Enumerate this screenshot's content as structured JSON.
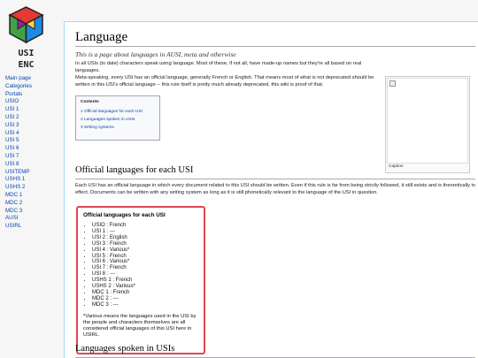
{
  "logo": {
    "line1": "USI",
    "line2": "ENC"
  },
  "sidebar": {
    "items": [
      "Main page",
      "Categories",
      "Portals",
      "USIO",
      "USI 1",
      "USI 2",
      "USI 3",
      "USI 4",
      "USI 5",
      "USI 6",
      "USI 7",
      "USI 8",
      "USITEMP",
      "USHS 1",
      "USHS 2",
      "MDC 1",
      "MDC 2",
      "MDC 3",
      "AUSI",
      "USIRL"
    ]
  },
  "page": {
    "title": "Language",
    "subtitle": "This is a page about languages in AUSI, meta and otherwise",
    "para1": "In all USIs (to date) characters speak using language. Most of these, if not all, have made-up names but they're all based on real languages.",
    "para2": "Meta-speaking, every USI has an official language, generally French or English. That means most of what is not deprecated should be written in this USI's official language -- this rule itself is pretty much already deprecated, this wiki is proof of that.",
    "section1_title": "Official languages for each USI",
    "section1_text": "Each USI has an official language in which every document related to this USI should be written. Even if this rule is far from being strictly followed, it still exists and is theoretically in effect. Documents can be written with any writing system as long as it is still phonetically relevant to the language of the USI in question.",
    "section2_title": "Languages spoken in USIs"
  },
  "toc": {
    "title": "Contents",
    "items": [
      "1 Official languages for each USI",
      "2 Languages spoken in USIs",
      "3 Writing systems"
    ]
  },
  "thumb": {
    "caption": "Caption"
  },
  "infobox": {
    "title": "Official languages for each USI",
    "items": [
      "USIO : French",
      "USI 1 : ---",
      "USI 2 : English",
      "USI 3 : French",
      "USI 4 : Various*",
      "USI 5 : French",
      "USI 6 : Various*",
      "USI 7 : French",
      "USI 8 : ---",
      "USHS 1 : French",
      "USHS 2 : Various*",
      "MDC 1 : French",
      "MDC 2 : ---",
      "MDC 3 : ---"
    ],
    "note": "*Various means the languages used in the USI by the people and characters themselves are all considered official languages of this USI here in USIRL."
  },
  "colors": {
    "link": "#0645ad",
    "infobox_border": "#e0474f"
  }
}
